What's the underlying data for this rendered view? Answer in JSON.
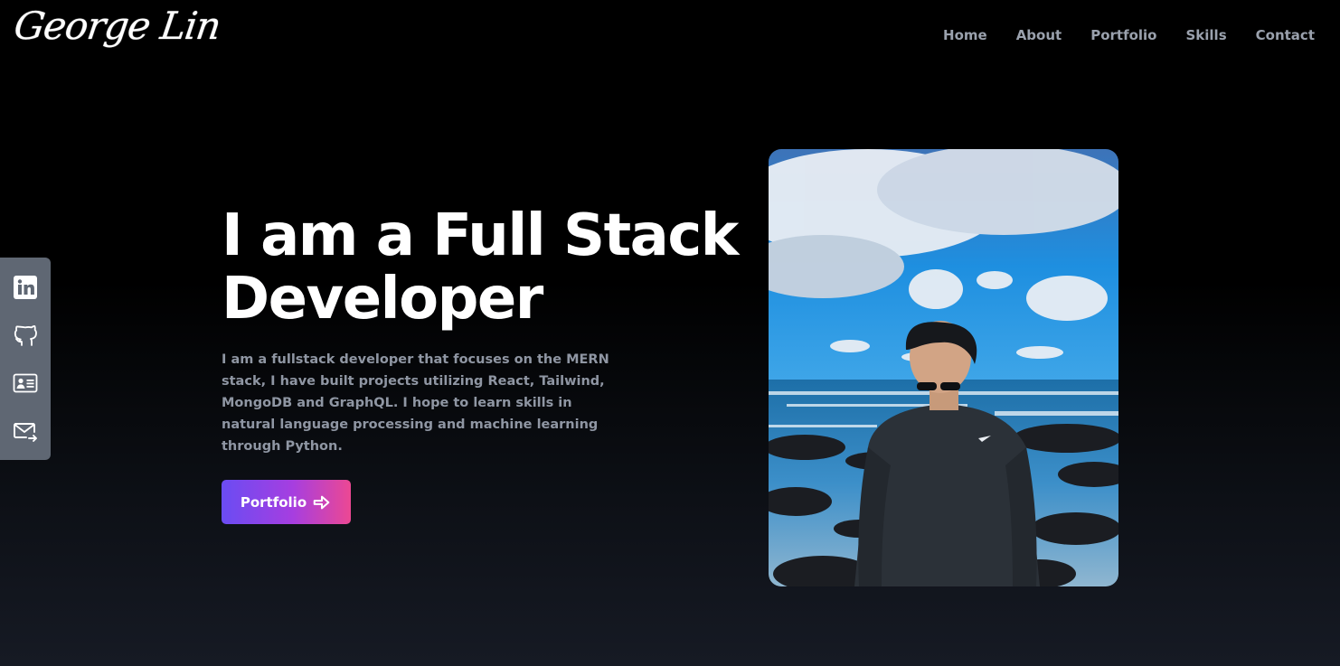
{
  "header": {
    "logo": "George Lin",
    "nav": [
      "Home",
      "About",
      "Portfolio",
      "Skills",
      "Contact"
    ]
  },
  "social": {
    "icons": [
      "linkedin-icon",
      "github-icon",
      "resume-icon",
      "mail-icon"
    ]
  },
  "hero": {
    "title_line1": "I am a Full Stack",
    "title_line2": "Developer",
    "intro": "I am a fullstack developer that focuses on the MERN stack, I have built projects utilizing React, Tailwind, MongoDB and GraphQL. I hope to learn skills in natural language processing and machine learning through Python.",
    "cta_label": "Portfolio",
    "cta_icon": "arrow-right-icon"
  },
  "colors": {
    "background": "#000000",
    "nav_text": "#9aa1ad",
    "sidebar": "#5f6773",
    "cta_gradient_start": "#6a4cf3",
    "cta_gradient_end": "#ec4893"
  }
}
